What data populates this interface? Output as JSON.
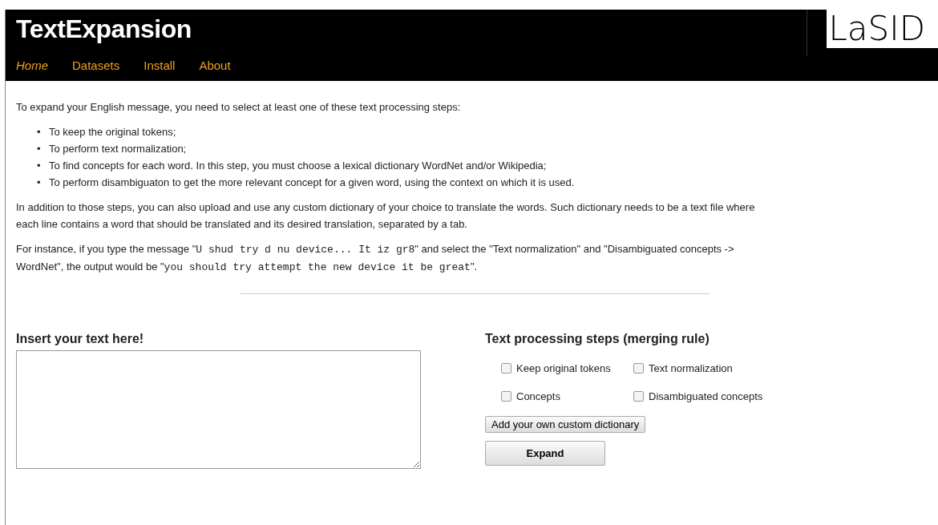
{
  "header": {
    "title": "TextExpansion",
    "logo": "LaSID",
    "nav": [
      {
        "label": "Home",
        "selected": true
      },
      {
        "label": "Datasets",
        "selected": false
      },
      {
        "label": "Install",
        "selected": false
      },
      {
        "label": "About",
        "selected": false
      }
    ]
  },
  "intro": "To expand your English message, you need to select at least one of these text processing steps:",
  "steps": [
    {
      "bullet": "•",
      "text": "To keep the original tokens;"
    },
    {
      "bullet": "•",
      "text": "To perform text normalization;"
    },
    {
      "bullet": "•",
      "text": "To find concepts for each word. In this step, you must choose a lexical dictionary WordNet and/or Wikipedia;"
    },
    {
      "bullet": "•",
      "text": "To perform disambiguaton to get the more relevant concept for a given word, using the context on which it is used."
    }
  ],
  "dictionary_note": "In addition to those steps, you can also upload and use any custom dictionary of your choice to translate the words. Such dictionary needs to be a text file where each line contains a word that should be translated and its desired translation, separated by a tab.",
  "example": [
    {
      "kind": "text",
      "text": "For instance, if you type the message \""
    },
    {
      "kind": "code",
      "text": "U shud try d nu device... It iz gr8"
    },
    {
      "kind": "text",
      "text": "\" and select the \"Text normalization\" and \"Disambiguated concepts -> WordNet\", the output would be \""
    },
    {
      "kind": "code",
      "text": "you should try attempt the new device it be great"
    },
    {
      "kind": "text",
      "text": "\"."
    }
  ],
  "input": {
    "heading": "Insert your text here!"
  },
  "options": {
    "heading": "Text processing steps (merging rule)",
    "checkboxes": [
      {
        "label": "Keep original tokens",
        "checked": false
      },
      {
        "label": "Text normalization",
        "checked": false
      },
      {
        "label": "Concepts",
        "checked": false
      },
      {
        "label": "Disambiguated concepts",
        "checked": false
      }
    ],
    "dictionary_button": "Add your own custom dictionary",
    "expand_button": "Expand"
  }
}
